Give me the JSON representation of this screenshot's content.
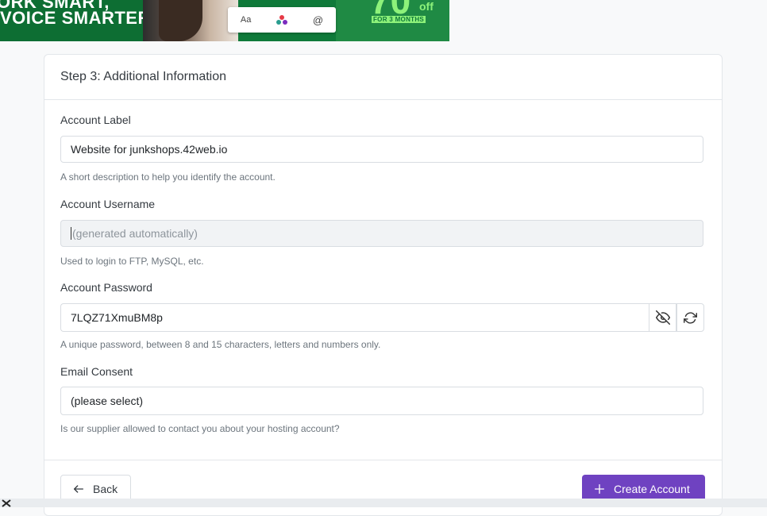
{
  "banner": {
    "line1": "ORK SMART,",
    "line2": "VOICE SMARTER",
    "card_aa": "Aa",
    "big_number": "70",
    "off": "off",
    "promo": "FOR 3 MONTHS"
  },
  "panel": {
    "title": "Step 3: Additional Information",
    "account_label": {
      "label": "Account Label",
      "value": "Website for junkshops.42web.io",
      "help": "A short description to help you identify the account."
    },
    "account_username": {
      "label": "Account Username",
      "placeholder": "(generated automatically)",
      "help": "Used to login to FTP, MySQL, etc."
    },
    "account_password": {
      "label": "Account Password",
      "value": "7LQZ71XmuBM8p",
      "help": "A unique password, between 8 and 15 characters, letters and numbers only."
    },
    "email_consent": {
      "label": "Email Consent",
      "selected": "(please select)",
      "help": "Is our supplier allowed to contact you about your hosting account?"
    },
    "back_label": "Back",
    "create_label": "Create Account"
  },
  "colors": {
    "primary": "#6f42c1",
    "banner_green": "#0f7a3a",
    "banner_accent": "#8df27a"
  }
}
